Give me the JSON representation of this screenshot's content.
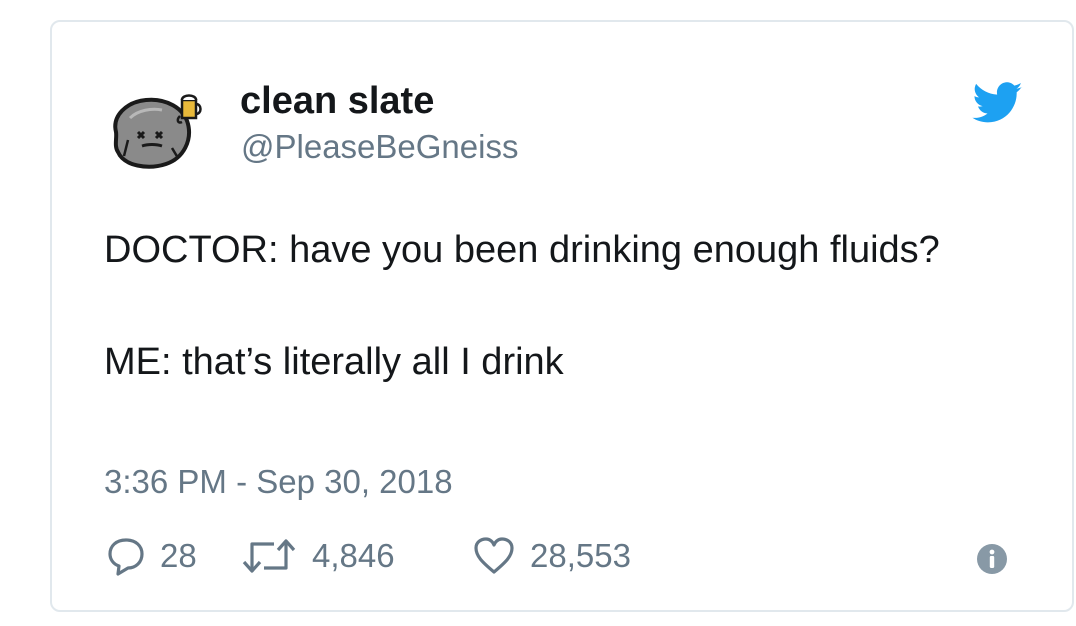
{
  "tweet": {
    "display_name": "clean slate",
    "handle": "@PleaseBeGneiss",
    "text": "DOCTOR: have you been drinking enough fluids?\n\nME: that’s literally all I drink",
    "timestamp": "3:36 PM - Sep 30, 2018"
  },
  "actions": {
    "replies": "28",
    "retweets": "4,846",
    "likes": "28,553"
  },
  "colors": {
    "brand_blue": "#1da1f2",
    "secondary_text": "#657786",
    "primary_text": "#14171a",
    "border": "#e1e8ed"
  },
  "icons": [
    "avatar-rock-with-beer",
    "twitter-bird-icon",
    "reply-icon",
    "retweet-icon",
    "heart-icon",
    "info-icon"
  ]
}
